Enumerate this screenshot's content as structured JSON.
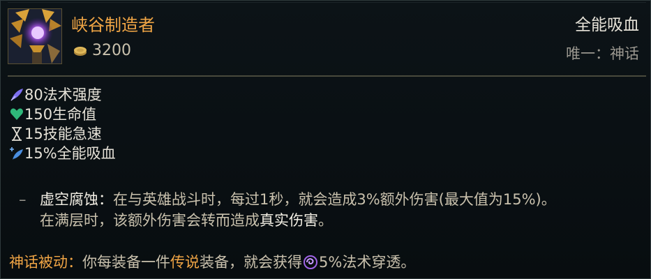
{
  "item": {
    "name": "峡谷制造者",
    "cost": "3200",
    "cost_icon": "gold-coin-icon",
    "rarity": "全能吸血",
    "limit": "唯一：神话",
    "image_icon": "riftmaker-item-icon"
  },
  "stats": [
    {
      "icon": "ability-power-icon",
      "text": "80法术强度"
    },
    {
      "icon": "health-icon",
      "text": "150生命值"
    },
    {
      "icon": "ability-haste-icon",
      "text": "15技能急速"
    },
    {
      "icon": "omnivamp-icon",
      "text": "15%全能吸血"
    }
  ],
  "passive": {
    "dash": "–",
    "name": "虚空腐蚀：",
    "line1": "在与英雄战斗时，每过1秒，就会造成3%额外伤害(最大值为15%)。",
    "line2_prefix": "在满层时，该额外伤害会转而造成",
    "line2_highlight": "真实伤害",
    "line2_suffix": "。"
  },
  "mythic": {
    "title": "神话被动：",
    "text_prefix": "你每装备一件",
    "legendary": "传说",
    "text_mid": "装备，就会获得",
    "icon": "magic-penetration-icon",
    "text_suffix": "5%法术穿透。"
  },
  "colors": {
    "accent_orange": "#f0a545",
    "text_primary": "#e6e2d8",
    "text_secondary": "#9b9890",
    "background": "#0a1014"
  }
}
